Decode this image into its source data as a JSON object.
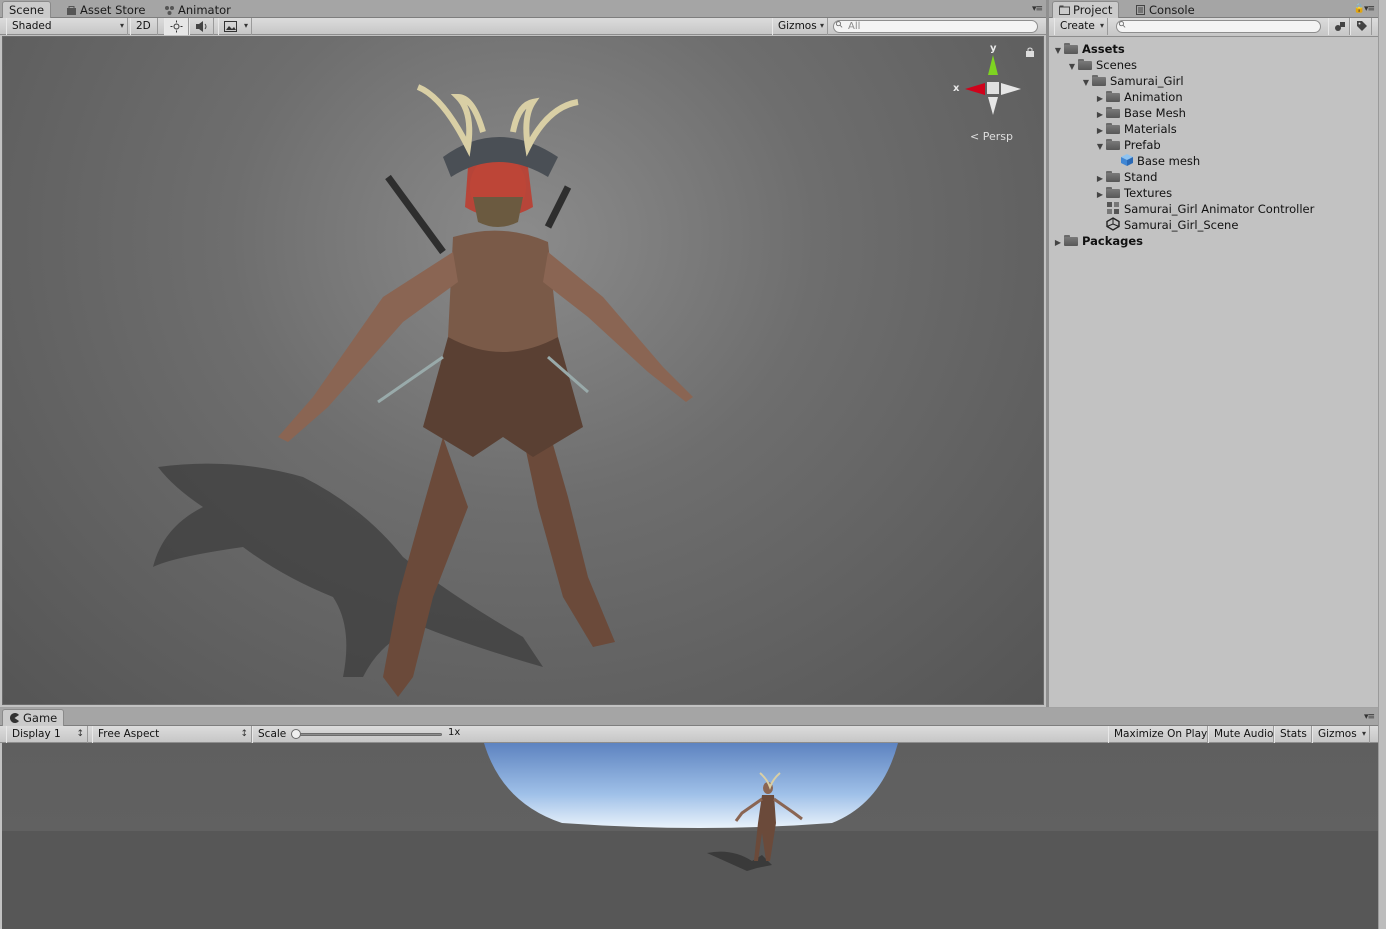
{
  "scene_panel": {
    "tabs": [
      {
        "label": "Scene"
      },
      {
        "label": "Asset Store"
      },
      {
        "label": "Animator"
      }
    ],
    "toolbar": {
      "shading_mode": "Shaded",
      "mode_2d": "2D",
      "gizmos": "Gizmos",
      "search_placeholder": "All"
    },
    "gizmo": {
      "y": "y",
      "x": "x",
      "projection": "Persp"
    }
  },
  "project_panel": {
    "tabs": [
      {
        "label": "Project"
      },
      {
        "label": "Console"
      }
    ],
    "toolbar": {
      "create": "Create"
    },
    "tree": [
      {
        "label": "Assets",
        "depth": 0,
        "expanded": true,
        "bold": true,
        "icon": "folder-icon"
      },
      {
        "label": "Scenes",
        "depth": 1,
        "expanded": true,
        "icon": "folder-icon"
      },
      {
        "label": "Samurai_Girl",
        "depth": 2,
        "expanded": true,
        "icon": "folder-icon"
      },
      {
        "label": "Animation",
        "depth": 3,
        "expanded": false,
        "icon": "folder-icon"
      },
      {
        "label": "Base Mesh",
        "depth": 3,
        "expanded": false,
        "icon": "folder-icon"
      },
      {
        "label": "Materials",
        "depth": 3,
        "expanded": false,
        "icon": "folder-icon"
      },
      {
        "label": "Prefab",
        "depth": 3,
        "expanded": true,
        "icon": "folder-icon"
      },
      {
        "label": "Base mesh",
        "depth": 4,
        "icon": "prefab-cube-icon"
      },
      {
        "label": "Stand",
        "depth": 3,
        "expanded": false,
        "icon": "folder-icon"
      },
      {
        "label": "Textures",
        "depth": 3,
        "expanded": false,
        "icon": "folder-icon"
      },
      {
        "label": "Samurai_Girl Animator Controller",
        "depth": 3,
        "icon": "animator-controller-icon"
      },
      {
        "label": "Samurai_Girl_Scene",
        "depth": 3,
        "icon": "unity-scene-icon"
      },
      {
        "label": "Packages",
        "depth": 0,
        "expanded": false,
        "bold": true,
        "icon": "folder-icon"
      }
    ]
  },
  "game_panel": {
    "tab": "Game",
    "toolbar": {
      "display": "Display 1",
      "aspect": "Free Aspect",
      "scale_label": "Scale",
      "scale_value": "1x",
      "maximize": "Maximize On Play",
      "mute": "Mute Audio",
      "stats": "Stats",
      "gizmos": "Gizmos"
    }
  },
  "colors": {
    "panel_bg": "#c2c2c2",
    "tab_bar": "#a5a5a5",
    "gizmo_y": "#7ed321",
    "gizmo_x": "#d0021b",
    "sky": "#6e9ad8"
  }
}
